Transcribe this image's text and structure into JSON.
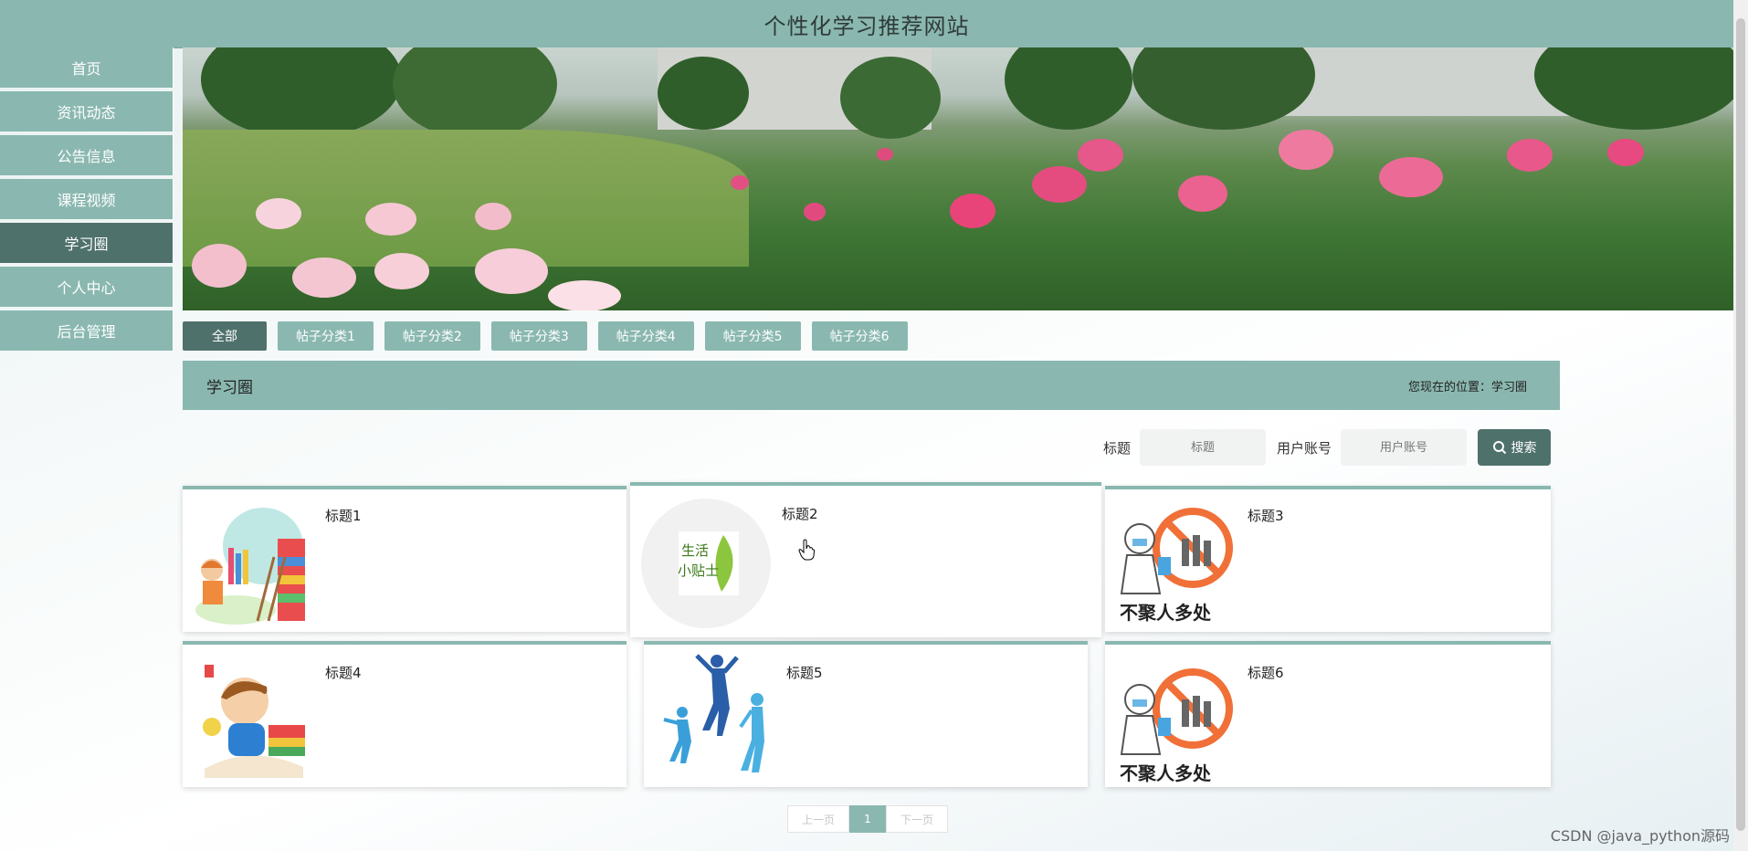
{
  "site": {
    "title": "个性化学习推荐网站"
  },
  "sidebar": {
    "items": [
      {
        "label": "首页"
      },
      {
        "label": "资讯动态"
      },
      {
        "label": "公告信息"
      },
      {
        "label": "课程视频"
      },
      {
        "label": "学习圈"
      },
      {
        "label": "个人中心"
      },
      {
        "label": "后台管理"
      }
    ],
    "active": "学习圈"
  },
  "categories": [
    "全部",
    "帖子分类1",
    "帖子分类2",
    "帖子分类3",
    "帖子分类4",
    "帖子分类5",
    "帖子分类6"
  ],
  "section": {
    "title": "学习圈",
    "breadcrumb": "您现在的位置：学习圈"
  },
  "search": {
    "title_label": "标题",
    "title_placeholder": "标题",
    "account_label": "用户账号",
    "account_placeholder": "用户账号",
    "button_label": "搜索"
  },
  "posts": [
    {
      "title": "标题1",
      "image": "children-reading-books-illustration"
    },
    {
      "title": "标题2",
      "image": "life-tips-leaf-logo"
    },
    {
      "title": "标题3",
      "image": "no-gathering-poster"
    },
    {
      "title": "标题4",
      "image": "boy-reading-illustration"
    },
    {
      "title": "标题5",
      "image": "jumping-people-silhouette"
    },
    {
      "title": "标题6",
      "image": "no-gathering-poster"
    }
  ],
  "poster_text": "不聚人多处",
  "life_tips_text": [
    "生活",
    "小贴士"
  ],
  "pagination": {
    "prev": "上一页",
    "current": "1",
    "next": "下一页"
  },
  "watermark": "CSDN @java_python源码",
  "colors": {
    "primary": "#8ab8b0",
    "active": "#4f716c"
  }
}
